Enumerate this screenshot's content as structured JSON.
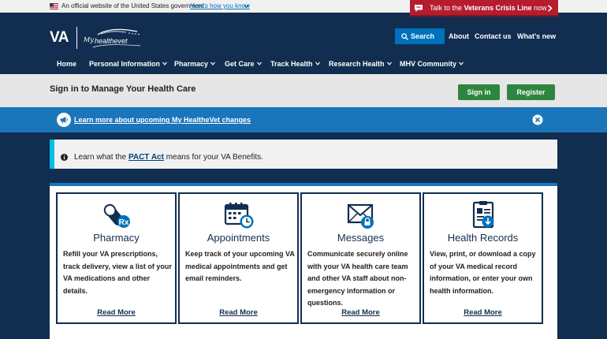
{
  "gov_banner": {
    "text": "An official website of the United States government.",
    "link": "Here's how you know"
  },
  "crisis_line": {
    "prefix": "Talk to the ",
    "bold": "Veterans Crisis Line",
    "suffix": " now"
  },
  "header": {
    "logo_va": "VA",
    "logo_my": "My",
    "logo_healthevet": "healthevet",
    "search_label": "Search",
    "links": [
      "About",
      "Contact us",
      "What's new"
    ]
  },
  "nav": {
    "items": [
      "Home",
      "Personal Information",
      "Pharmacy",
      "Get Care",
      "Track Health",
      "Research Health",
      "MHV Community"
    ]
  },
  "signin": {
    "title": "Sign in to Manage Your Health Care",
    "sign_in_label": "Sign in",
    "register_label": "Register"
  },
  "info_banner": {
    "link": "Learn more about upcoming My HealtheVet changes"
  },
  "pact_alert": {
    "before": "Learn what the ",
    "link": "PACT Act",
    "after": " means for your VA Benefits."
  },
  "cards": [
    {
      "icon": "pill-bottle-icon",
      "title": "Pharmacy",
      "description": "Refill your VA prescriptions, track delivery, view a list of your VA medications and other details.",
      "link": "Read More"
    },
    {
      "icon": "calendar-clock-icon",
      "title": "Appointments",
      "description": "Keep track of your upcoming VA medical appointments and get email reminders.",
      "link": "Read More"
    },
    {
      "icon": "envelope-lock-icon",
      "title": "Messages",
      "description": "Communicate securely online with your VA health care team and other VA staff about non-emergency information or questions.",
      "link": "Read More"
    },
    {
      "icon": "medical-record-icon",
      "title": "Health Records",
      "description": "View, print, or download a copy of your VA medical record information, or enter your own health information.",
      "link": "Read More"
    }
  ],
  "colors": {
    "navy": "#112e51",
    "blue": "#1b75bb",
    "crisis_red": "#b51c2e",
    "green": "#2e8540",
    "cyan": "#02bfe7"
  }
}
